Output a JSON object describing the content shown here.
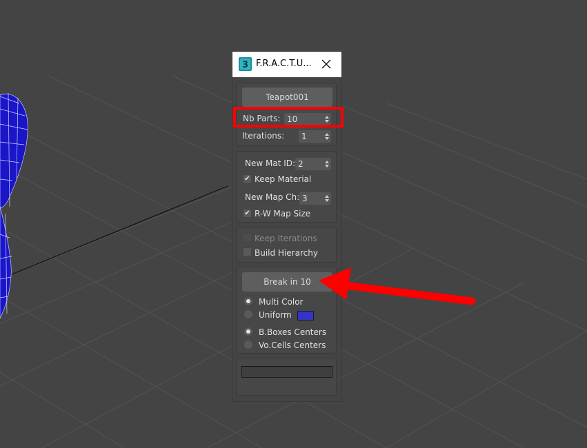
{
  "window": {
    "title": "F.R.A.C.T.U...",
    "app_icon": "3ds-max-icon",
    "close_icon": "close-icon"
  },
  "object_button": "Teapot001",
  "nb_parts": {
    "label": "Nb Parts:",
    "value": "10"
  },
  "iterations": {
    "label": "Iterations:",
    "value": "1"
  },
  "new_mat_id": {
    "label": "New Mat ID:",
    "value": "2"
  },
  "keep_material": {
    "label": "Keep Material",
    "checked": true
  },
  "new_map_ch": {
    "label": "New Map Ch:",
    "value": "3"
  },
  "rw_map_size": {
    "label": "R-W Map Size",
    "checked": true
  },
  "keep_iterations": {
    "label": "Keep Iterations",
    "checked": false,
    "enabled": false
  },
  "build_hierarchy": {
    "label": "Build Hierarchy",
    "checked": false
  },
  "break_button": "Break in 10",
  "color_mode": {
    "options": [
      "Multi Color",
      "Uniform"
    ],
    "selected": "Multi Color",
    "uniform_color": "#3434c8"
  },
  "centers_mode": {
    "options": [
      "B.Boxes Centers",
      "Vo.Cells Centers"
    ],
    "selected": "B.Boxes Centers"
  },
  "progress": 0,
  "colors": {
    "highlight": "#ff0000",
    "viewport_bg": "#444444",
    "teapot": "#1a16c8"
  }
}
